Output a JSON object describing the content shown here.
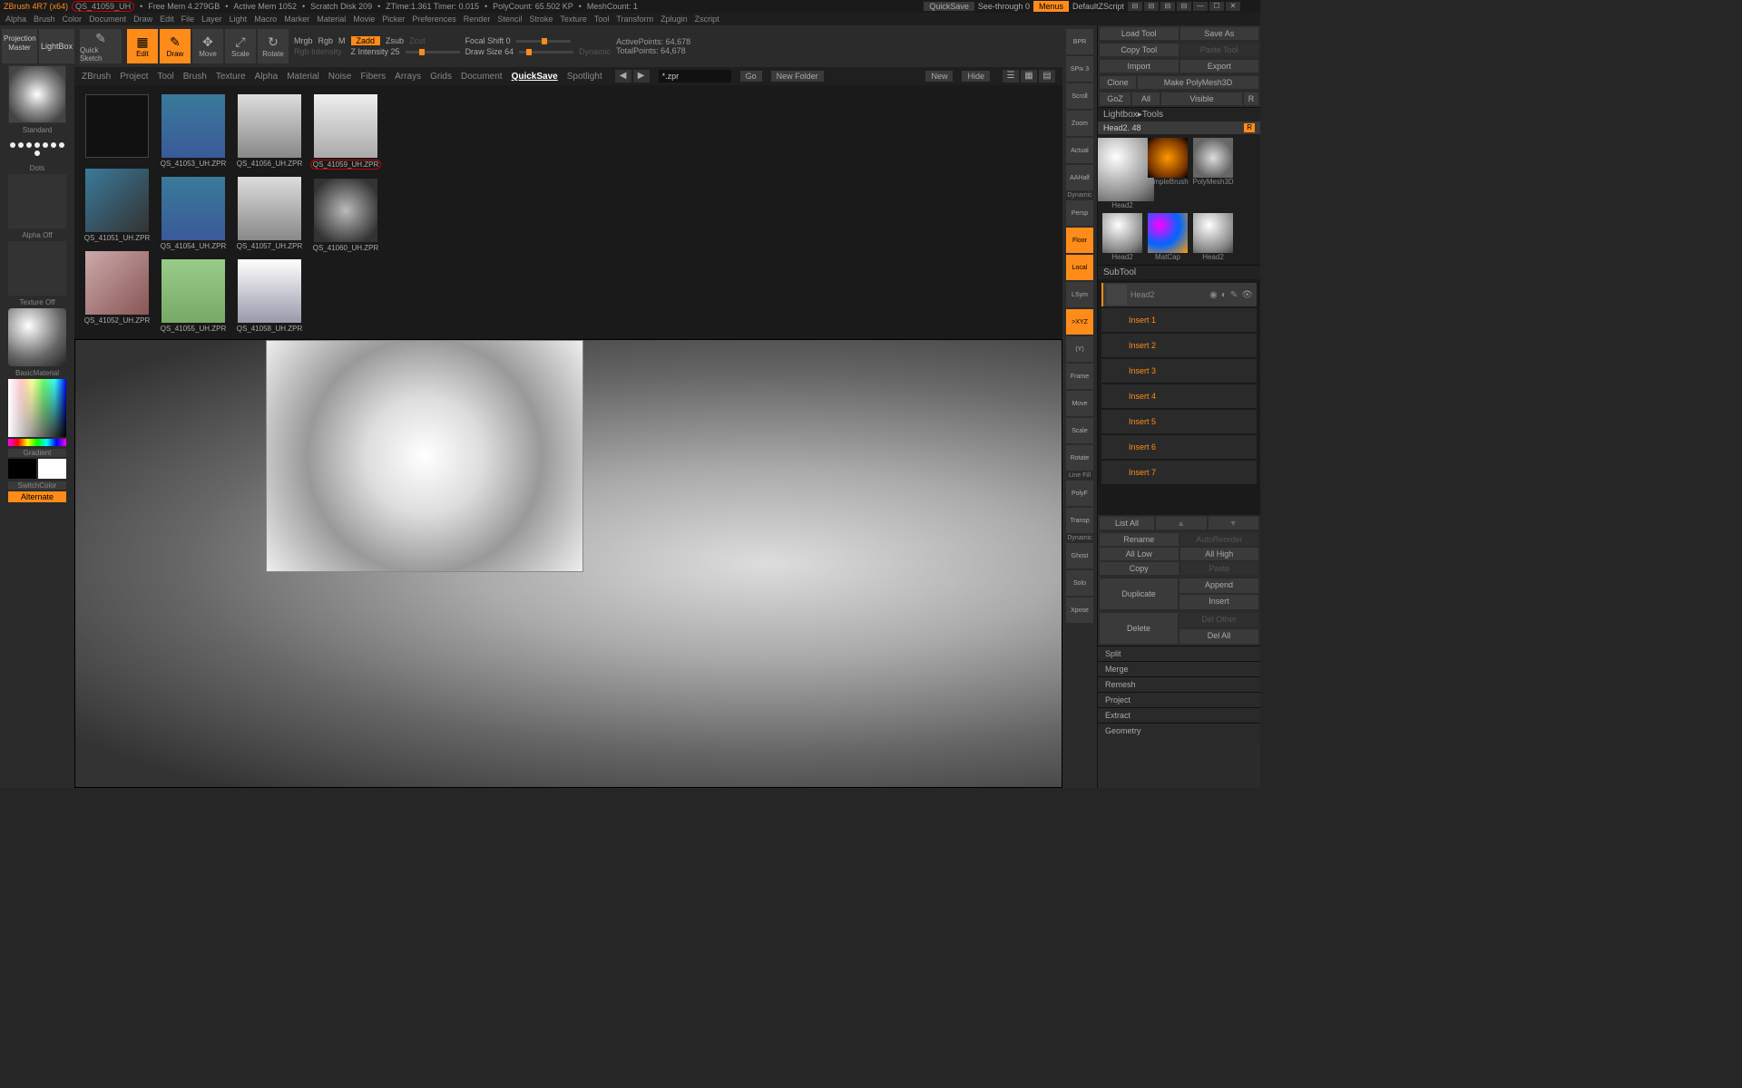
{
  "title": {
    "brand": "ZBrush 4R7 (x64)",
    "file": "QS_41059_UH",
    "free_mem": "Free Mem 4.279GB",
    "active_mem": "Active Mem 1052",
    "scratch": "Scratch Disk 209",
    "ztime": "ZTime:1.361 Timer: 0.015",
    "polycount": "PolyCount: 65.502 KP",
    "meshcount": "MeshCount: 1"
  },
  "menus": [
    "Alpha",
    "Brush",
    "Color",
    "Document",
    "Draw",
    "Edit",
    "File",
    "Layer",
    "Light",
    "Macro",
    "Marker",
    "Material",
    "Movie",
    "Picker",
    "Preferences",
    "Render",
    "Stencil",
    "Stroke",
    "Texture",
    "Tool",
    "Transform",
    "Zplugin",
    "Zscript"
  ],
  "topright": {
    "quicksave": "QuickSave",
    "seethrough": "See-through  0",
    "menus": "Menus",
    "defaultzscript": "DefaultZScript"
  },
  "leftcol": {
    "projection": "Projection Master",
    "lightbox": "LightBox",
    "standard": "Standard",
    "dots": "Dots",
    "alpha": "Alpha Off",
    "texture": "Texture Off",
    "material": "BasicMaterial",
    "gradient": "Gradient",
    "switch": "SwitchColor",
    "alternate": "Alternate"
  },
  "toolbar": {
    "quicksketch": "Quick Sketch",
    "edit": "Edit",
    "draw": "Draw",
    "move": "Move",
    "scale": "Scale",
    "rotate": "Rotate",
    "mrgb": "Mrgb",
    "rgb": "Rgb",
    "m": "M",
    "rgbint": "Rgb Intensity",
    "zadd": "Zadd",
    "zsub": "Zsub",
    "zcut": "Zcut",
    "zintensity": "Z Intensity 25",
    "focal": "Focal Shift 0",
    "drawsize": "Draw Size 64",
    "dynamic": "Dynamic",
    "activepoints": "ActivePoints: 64,678",
    "totalpoints": "TotalPoints: 64,678"
  },
  "lightbox": {
    "tabs": [
      "ZBrush",
      "Project",
      "Tool",
      "Brush",
      "Texture",
      "Alpha",
      "Material",
      "Noise",
      "Fibers",
      "Arrays",
      "Grids",
      "Document",
      "QuickSave",
      "Spotlight"
    ],
    "active": "QuickSave",
    "ext": "*.zpr",
    "go": "Go",
    "newfolder": "New Folder",
    "new": "New",
    "hide": "Hide"
  },
  "thumbs": [
    {
      "label": "",
      "cls": "th-folder"
    },
    {
      "label": "QS_41053_UH.ZPR",
      "cls": "th-body"
    },
    {
      "label": "QS_41056_UH.ZPR",
      "cls": "th-cloth"
    },
    {
      "label": "QS_41059_UH.ZPR",
      "cls": "th-hand",
      "circled": true
    },
    {
      "label": "QS_41051_UH.ZPR",
      "cls": "th-leg"
    },
    {
      "label": "QS_41054_UH.ZPR",
      "cls": "th-body"
    },
    {
      "label": "QS_41057_UH.ZPR",
      "cls": "th-cloth"
    },
    {
      "label": "QS_41060_UH.ZPR",
      "cls": "th-star"
    },
    {
      "label": "QS_41052_UH.ZPR",
      "cls": "th-face"
    },
    {
      "label": "QS_41055_UH.ZPR",
      "cls": "th-dress"
    },
    {
      "label": "QS_41058_UH.ZPR",
      "cls": "th-hand2"
    }
  ],
  "rtools": [
    {
      "l": "BPR",
      "a": false
    },
    {
      "l": "SPix 3",
      "a": false
    },
    {
      "l": "Scroll",
      "a": false
    },
    {
      "l": "Zoom",
      "a": false
    },
    {
      "l": "Actual",
      "a": false
    },
    {
      "l": "AAHalf",
      "a": false
    },
    {
      "l": "Persp",
      "a": false
    },
    {
      "l": "Floor",
      "a": true
    },
    {
      "l": "Local",
      "a": true
    },
    {
      "l": "LSym",
      "a": false
    },
    {
      "l": ">XYZ",
      "a": true
    },
    {
      "l": "(Y)",
      "a": false
    },
    {
      "l": "Frame",
      "a": false
    },
    {
      "l": "Move",
      "a": false
    },
    {
      "l": "Scale",
      "a": false
    },
    {
      "l": "Rotate",
      "a": false
    },
    {
      "l": "PolyF",
      "a": false
    },
    {
      "l": "Transp",
      "a": false
    },
    {
      "l": "Ghost",
      "a": false
    },
    {
      "l": "Solo",
      "a": false
    },
    {
      "l": "Xpose",
      "a": false
    }
  ],
  "rpanel": {
    "row1": [
      "Load Tool",
      "Save As"
    ],
    "copytool": "Copy Tool",
    "pastetool": "Paste Tool",
    "import": "Import",
    "export": "Export",
    "clone": "Clone",
    "makepoly": "Make PolyMesh3D",
    "row4": [
      "GoZ",
      "All",
      "Visible",
      "R"
    ],
    "lightboxtools": "Lightbox▸Tools",
    "head": "Head2. 48",
    "tools": [
      {
        "n": "Head2",
        "c": "headimg"
      },
      {
        "n": "SimpleBrush",
        "c": "simplebrush"
      },
      {
        "n": "PolyMesh3D",
        "c": "polystar"
      },
      {
        "n": "Head2",
        "c": "headimg"
      },
      {
        "n": "MatCap",
        "c": "matcap"
      },
      {
        "n": "Head2",
        "c": "headimg"
      }
    ],
    "subtool": "SubTool",
    "sublist": [
      "Head2",
      "Insert 1",
      "Insert 2",
      "Insert 3",
      "Insert 4",
      "Insert 5",
      "Insert 6",
      "Insert 7"
    ],
    "listall": "List All",
    "rename": "Rename",
    "autoreorder": "AutoReorder",
    "alllow": "All Low",
    "allhigh": "All High",
    "copy": "Copy",
    "paste": "Paste",
    "duplicate": "Duplicate",
    "append": "Append",
    "insert": "Insert",
    "delete": "Delete",
    "delother": "Del Other",
    "delall": "Del All",
    "collapse": [
      "Split",
      "Merge",
      "Remesh",
      "Project",
      "Extract",
      "Geometry"
    ]
  }
}
